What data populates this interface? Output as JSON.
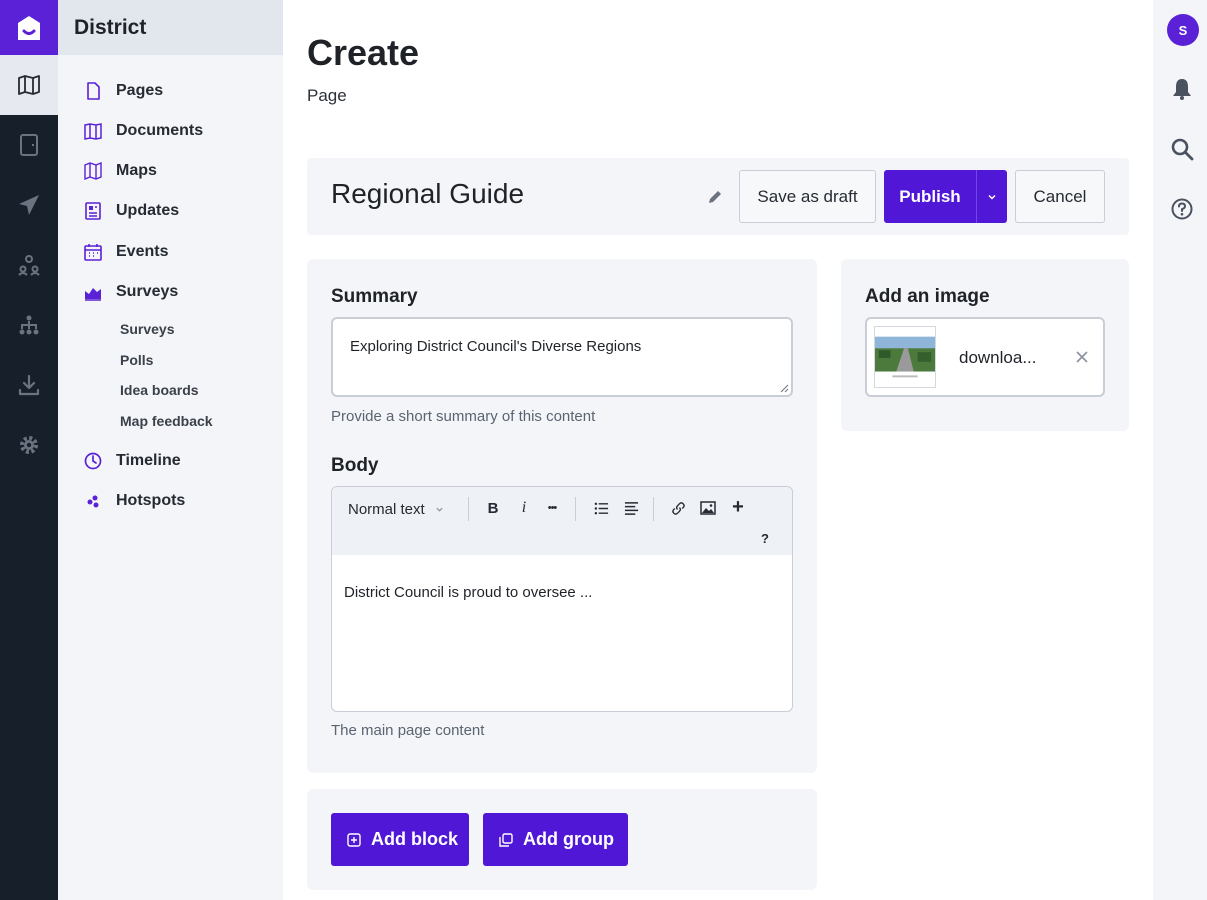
{
  "rail": {
    "items": [
      "book-open-icon",
      "tablet-icon",
      "send-icon",
      "users-icon",
      "org-chart-icon",
      "download-icon",
      "settings-icon"
    ]
  },
  "sidebar": {
    "title": "District",
    "items": [
      {
        "label": "Pages",
        "icon": "page-icon"
      },
      {
        "label": "Documents",
        "icon": "documents-icon"
      },
      {
        "label": "Maps",
        "icon": "map-icon"
      },
      {
        "label": "Updates",
        "icon": "updates-icon"
      },
      {
        "label": "Events",
        "icon": "calendar-icon"
      },
      {
        "label": "Surveys",
        "icon": "chart-icon"
      },
      {
        "label": "Timeline",
        "icon": "clock-icon"
      },
      {
        "label": "Hotspots",
        "icon": "hotspots-icon"
      }
    ],
    "sub_items": [
      "Surveys",
      "Polls",
      "Idea boards",
      "Map feedback"
    ]
  },
  "user": {
    "initial": "S"
  },
  "header": {
    "title": "Create",
    "subtitle": "Page"
  },
  "page": {
    "name": "Regional Guide"
  },
  "actions": {
    "save_draft": "Save as draft",
    "publish": "Publish",
    "cancel": "Cancel"
  },
  "summary": {
    "label": "Summary",
    "value": "Exploring District Council's Diverse Regions",
    "help": "Provide a short summary of this content"
  },
  "body": {
    "label": "Body",
    "text_style": "Normal text",
    "toolbar": {
      "bold": "B",
      "italic": "i",
      "more": "•••",
      "add": "+",
      "help": "?"
    },
    "content": "District Council is proud to oversee ...",
    "help": "The main page content"
  },
  "image": {
    "label": "Add an image",
    "filename": "downloa..."
  },
  "blocks": {
    "add_block": "Add block",
    "add_group": "Add group"
  },
  "colors": {
    "accent": "#5117d6",
    "rail": "#171f2b",
    "panel": "#f3f5f8"
  }
}
